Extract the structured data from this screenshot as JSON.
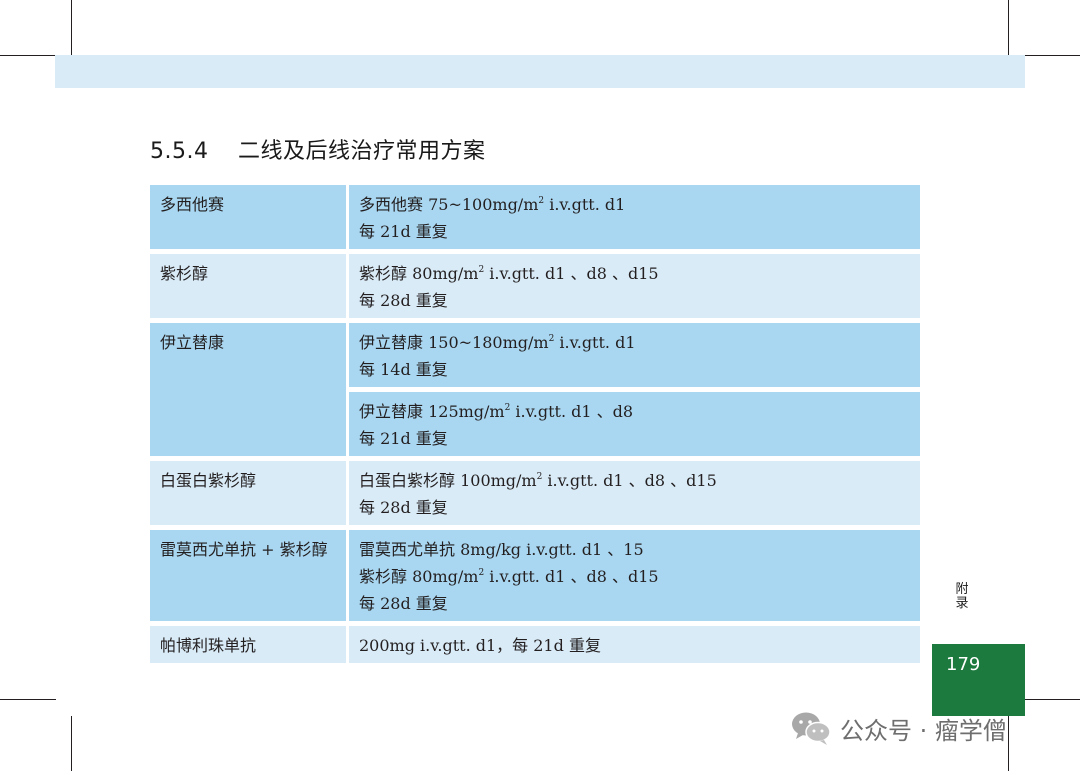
{
  "section": {
    "number": "5.5.4",
    "title": "二线及后线治疗常用方案"
  },
  "table": {
    "rows": [
      {
        "drug": "多西他赛",
        "regimens": [
          {
            "parts": [
              "多西他赛 75~100mg/m",
              "2",
              " i.v.gtt. d1"
            ],
            "cycle": "每 21d 重复"
          }
        ]
      },
      {
        "drug": "紫杉醇",
        "regimens": [
          {
            "parts": [
              "紫杉醇 80mg/m",
              "2",
              " i.v.gtt. d1 、d8 、d15"
            ],
            "cycle": "每 28d 重复"
          }
        ]
      },
      {
        "drug": "伊立替康",
        "regimens": [
          {
            "parts": [
              "伊立替康 150~180mg/m",
              "2",
              " i.v.gtt. d1"
            ],
            "cycle": "每 14d 重复"
          },
          {
            "parts": [
              "伊立替康 125mg/m",
              "2",
              " i.v.gtt. d1 、d8"
            ],
            "cycle": "每 21d 重复"
          }
        ]
      },
      {
        "drug": "白蛋白紫杉醇",
        "regimens": [
          {
            "parts": [
              "白蛋白紫杉醇 100mg/m",
              "2",
              " i.v.gtt. d1 、d8 、d15"
            ],
            "cycle": "每 28d 重复"
          }
        ]
      },
      {
        "drug": "雷莫西尤单抗 + 紫杉醇",
        "regimens": [
          {
            "line1": "雷莫西尤单抗 8mg/kg i.v.gtt. d1 、15",
            "parts": [
              "紫杉醇 80mg/m",
              "2",
              " i.v.gtt. d1 、d8 、d15"
            ],
            "cycle": "每 28d 重复"
          }
        ]
      },
      {
        "drug": "帕博利珠单抗",
        "regimens": [
          {
            "single": "200mg i.v.gtt. d1，每 21d 重复"
          }
        ]
      }
    ]
  },
  "side_label": [
    "附",
    "录"
  ],
  "page_number": "179",
  "watermark": "公众号 · 瘤学僧",
  "colors": {
    "header_band": "#d9ebf7",
    "row_dark": "#a9d7f1",
    "row_light": "#d9ebf7",
    "page_box": "#1c7a3e"
  },
  "icons": [
    "wechat-icon"
  ]
}
